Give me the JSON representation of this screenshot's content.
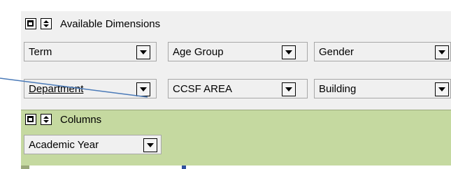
{
  "available": {
    "title": "Available Dimensions",
    "fields": [
      {
        "label": "Term"
      },
      {
        "label": "Age Group"
      },
      {
        "label": "Gender"
      },
      {
        "label": "Department"
      },
      {
        "label": "CCSF AREA"
      },
      {
        "label": "Building"
      }
    ]
  },
  "columns": {
    "title": "Columns",
    "fields": [
      {
        "label": "Academic Year"
      }
    ]
  },
  "colors": {
    "panel_bg": "#f0f0f0",
    "columns_bg": "#c5d9a0",
    "pointer_line": "#4a7ab8"
  }
}
